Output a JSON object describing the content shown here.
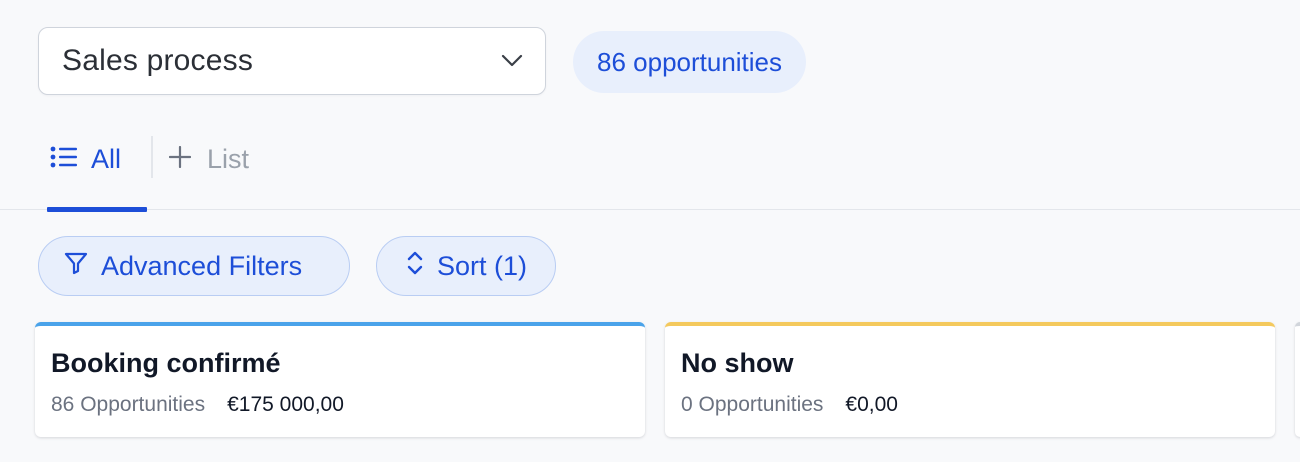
{
  "header": {
    "pipeline_select_value": "Sales process",
    "opportunity_count_label": "86 opportunities"
  },
  "tabs": {
    "all_label": "All",
    "add_list_label": "List"
  },
  "toolbar": {
    "advanced_filters_label": "Advanced Filters",
    "sort_label": "Sort (1)"
  },
  "stages": [
    {
      "title": "Booking confirmé",
      "count_label": "86 Opportunities",
      "amount": "€175 000,00",
      "color": "#4aa3ea"
    },
    {
      "title": "No show",
      "count_label": "0 Opportunities",
      "amount": "€0,00",
      "color": "#f4c95d"
    }
  ],
  "icons": [
    "chevron-down-icon",
    "list-icon",
    "plus-icon",
    "filter-icon",
    "sort-icon"
  ],
  "colors": {
    "accent": "#1d4ed8",
    "pill_bg": "#e8effc",
    "background": "#f8f9fb"
  }
}
